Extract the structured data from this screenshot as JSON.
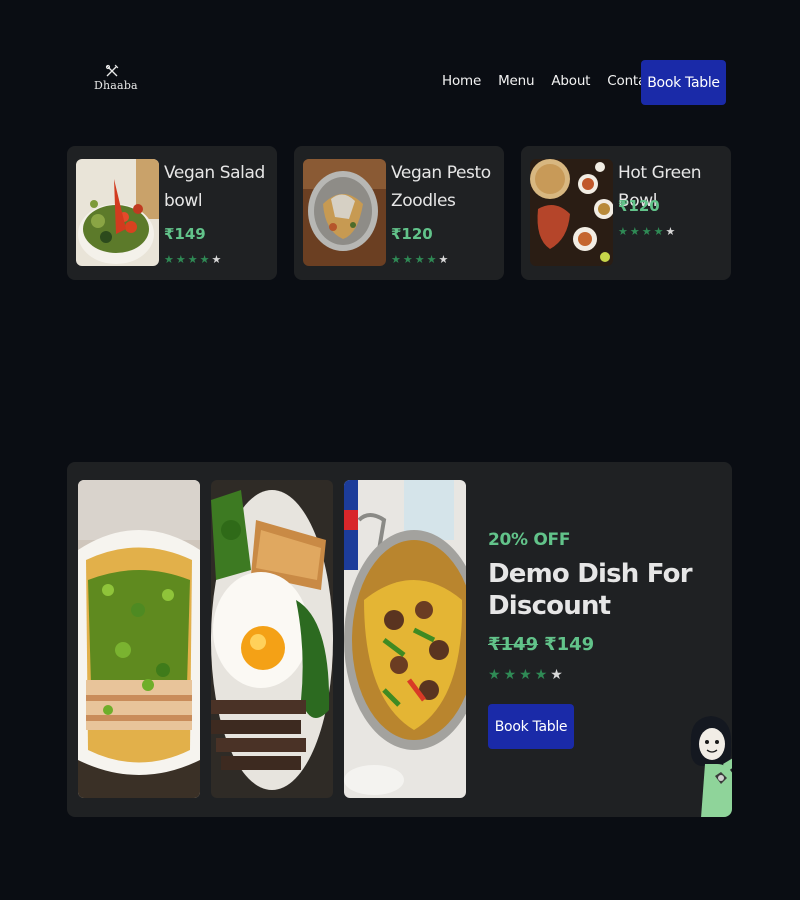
{
  "brand": {
    "name": "Dhaaba",
    "icon": "fork-knife-crossed-icon"
  },
  "nav": {
    "items": [
      "Home",
      "Menu",
      "About",
      "Contact"
    ],
    "cta": "Book Table"
  },
  "dishes": [
    {
      "name": "Vegan Salad bowl",
      "price": "₹149",
      "rating": 4,
      "max_rating": 5,
      "image": "salad-bowl-photo"
    },
    {
      "name": "Vegan Pesto Zoodles",
      "price": "₹120",
      "rating": 4,
      "max_rating": 5,
      "image": "pesto-zoodles-photo"
    },
    {
      "name": "Hot Green Bowl",
      "price": "₹120",
      "rating": 4,
      "max_rating": 5,
      "image": "indian-thali-photo"
    }
  ],
  "promo": {
    "offer": "20% OFF",
    "title": "Demo Dish For Discount",
    "old_price": "₹149",
    "new_price": "₹149",
    "rating": 4,
    "max_rating": 5,
    "cta": "Book Table",
    "images": [
      "noodle-bowl-photo",
      "fried-egg-plate-photo",
      "stir-fry-pan-photo"
    ],
    "mascot": "chef-character-illustration"
  },
  "colors": {
    "background": "#0a0d13",
    "card": "#1f2123",
    "accent": "#62c38a",
    "button": "#1a2aa8",
    "star_on": "#2f8a55",
    "star_off": "#d8d8d8"
  }
}
